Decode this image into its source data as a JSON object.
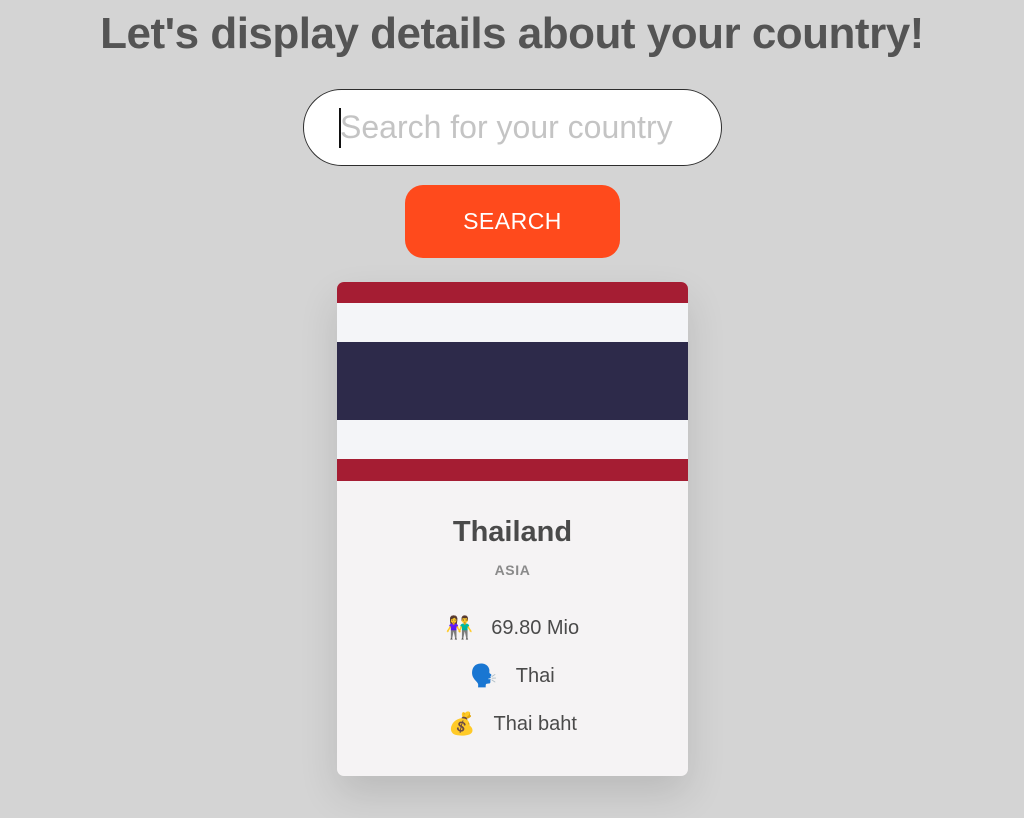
{
  "header": {
    "title": "Let's display details about your country!"
  },
  "search": {
    "placeholder": "Search for your country",
    "value": "",
    "button_label": "SEARCH"
  },
  "country_card": {
    "name": "Thailand",
    "region": "ASIA",
    "flag_colors": [
      "#a51d33",
      "#f4f5f8",
      "#2d2a4a",
      "#f4f5f8",
      "#a51d33"
    ],
    "population": {
      "icon": "people-holding-hands-icon",
      "glyph": "👫",
      "value": "69.80 Mio"
    },
    "language": {
      "icon": "speaking-head-icon",
      "glyph": "🗣️",
      "value": "Thai"
    },
    "currency": {
      "icon": "money-bag-icon",
      "glyph": "💰",
      "value": "Thai baht"
    }
  },
  "colors": {
    "background": "#d4d4d4",
    "accent": "#ff4a1c",
    "title_text": "#545454"
  }
}
